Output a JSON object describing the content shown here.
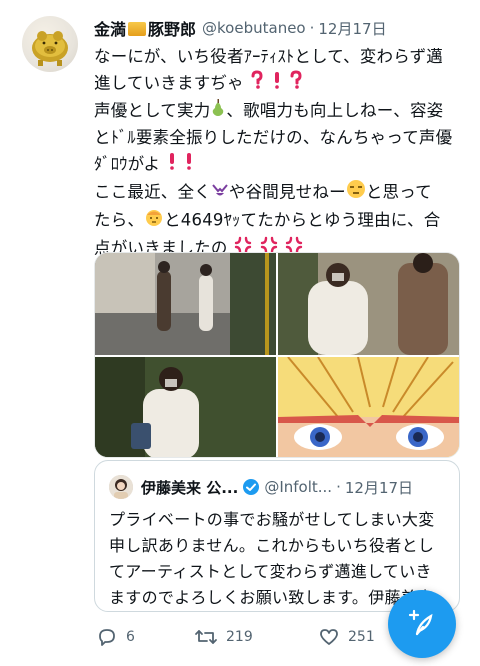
{
  "tweet": {
    "author_name_prefix": "金満",
    "author_name_suffix": "豚野郎",
    "handle": "@koebutaneo",
    "separator": "·",
    "time": "12月17日",
    "lines": [
      "なーにが、いち役者ｱｰﾃｨｽﾄとして、変わらず邁",
      "進していきますぢゃ",
      "声優として実力",
      "、歌唱力も向上しねー、容姿",
      "とﾄﾞﾙ要素全振りしただけの、なんちゃって声優",
      "ﾀﾞﾛｳがよ",
      "ここ最近、全く",
      "や谷間見せねー",
      "と思って",
      "たら、",
      "と4649ﾔｯてたからとゆう理由に、合",
      "点がいきましたの"
    ]
  },
  "quote": {
    "name": "伊藤美来 公...",
    "handle": "@Infolt...",
    "separator": "·",
    "time": "12月17日",
    "text_lines": [
      "プライベートの事でお騒がせしてしまい大変",
      "申し訳ありません。これからもいち役者とし",
      "てアーティストとして変わらず邁進していき",
      "ますのでよろしくお願い致します。伊藤美来"
    ]
  },
  "actions": {
    "replies": "6",
    "retweets": "219",
    "likes": "251"
  },
  "icons": {
    "reply": "reply-icon",
    "retweet": "retweet-icon",
    "like": "heart-icon",
    "compose": "compose-icon",
    "verified": "verified-badge-icon"
  },
  "colors": {
    "accent": "#1d9bf0",
    "secondary_text": "#536471",
    "emphasis": "#e0245e"
  }
}
